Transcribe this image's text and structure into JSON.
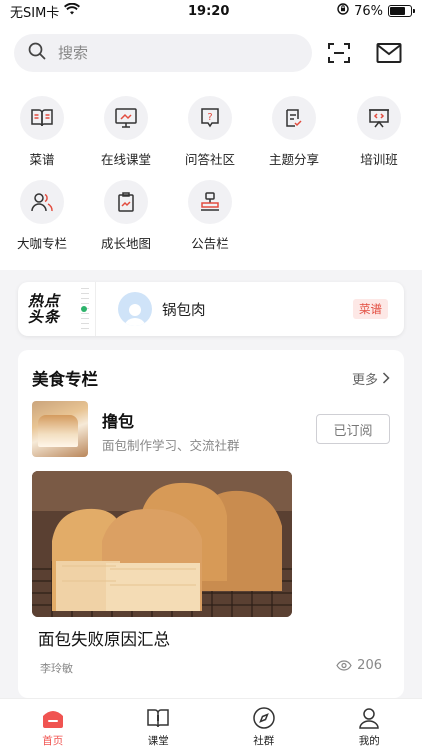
{
  "status_bar": {
    "carrier": "无SIM卡",
    "time": "19:20",
    "battery": "76%",
    "battery_level": 0.76
  },
  "search": {
    "placeholder": "搜索"
  },
  "quick_grid": [
    {
      "label": "菜谱",
      "icon": "recipe-book-icon"
    },
    {
      "label": "在线课堂",
      "icon": "online-class-icon"
    },
    {
      "label": "问答社区",
      "icon": "qa-icon"
    },
    {
      "label": "主题分享",
      "icon": "share-doc-icon"
    },
    {
      "label": "培训班",
      "icon": "training-board-icon"
    },
    {
      "label": "大咖专栏",
      "icon": "experts-icon"
    },
    {
      "label": "成长地图",
      "icon": "growth-map-icon"
    },
    {
      "label": "公告栏",
      "icon": "stamp-icon"
    }
  ],
  "hot_news": {
    "logo_line1": "热点",
    "logo_line2": "头条",
    "name": "锅包肉",
    "tag": "菜谱"
  },
  "food_column": {
    "title": "美食专栏",
    "more": "更多",
    "name": "撸包",
    "desc": "面包制作学习、交流社群",
    "subscribe": "已订阅",
    "article": {
      "title": "面包失败原因汇总",
      "author": "李玲敏",
      "views": "206"
    }
  },
  "tabs": [
    {
      "label": "首页",
      "icon": "home-icon",
      "active": true
    },
    {
      "label": "课堂",
      "icon": "classroom-book-icon",
      "active": false
    },
    {
      "label": "社群",
      "icon": "compass-icon",
      "active": false
    },
    {
      "label": "我的",
      "icon": "person-icon",
      "active": false
    }
  ],
  "colors": {
    "accent": "#f05451",
    "tag_bg": "#fde8e6",
    "tag_text": "#e24c3f"
  }
}
